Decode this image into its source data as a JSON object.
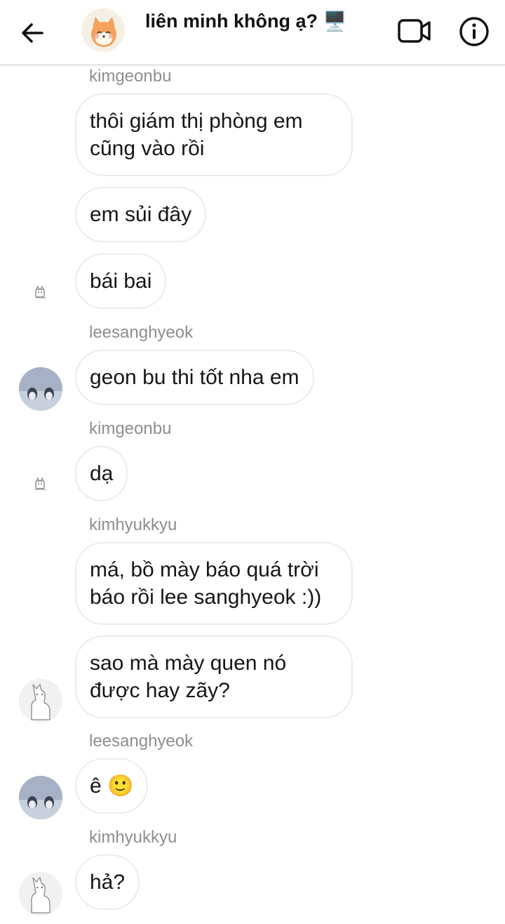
{
  "header": {
    "title": "liên minh không ạ? 🖥️"
  },
  "messages": [
    {
      "sender": "kimgeonbu",
      "lines": [
        "thôi giám thị phòng em",
        "cũng vào rồi"
      ]
    },
    {
      "lines": [
        "em sủi đây"
      ]
    },
    {
      "lines": [
        "bái bai"
      ]
    },
    {
      "sender": "leesanghyeok",
      "lines": [
        "geon bu thi tốt nha em"
      ]
    },
    {
      "sender": "kimgeonbu",
      "lines": [
        "dạ"
      ]
    },
    {
      "sender": "kimhyukkyu",
      "lines": [
        "má, bồ mày báo quá trời",
        "báo rồi lee sanghyeok :))"
      ]
    },
    {
      "lines": [
        "sao mà mày quen nó",
        "được hay zãy?"
      ]
    },
    {
      "sender": "leesanghyeok",
      "lines": [
        "ê 🙂"
      ]
    },
    {
      "sender": "kimhyukkyu",
      "lines": [
        "hả?"
      ]
    }
  ],
  "colors": {
    "bubble_border": "#ececec",
    "sender_text": "#8e8e8e",
    "penguin_avatar_bg": "#a7b1c6"
  }
}
